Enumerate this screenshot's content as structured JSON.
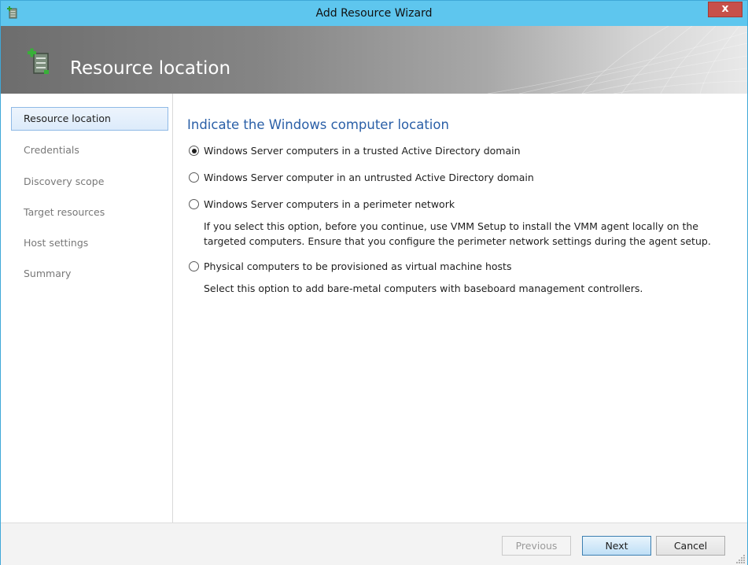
{
  "window": {
    "title": "Add Resource Wizard",
    "close_label": "x",
    "app_icon": "server-add-icon"
  },
  "banner": {
    "title": "Resource location",
    "icon": "server-add-icon"
  },
  "sidebar": {
    "items": [
      {
        "label": "Resource location",
        "active": true
      },
      {
        "label": "Credentials",
        "active": false
      },
      {
        "label": "Discovery scope",
        "active": false
      },
      {
        "label": "Target resources",
        "active": false
      },
      {
        "label": "Host settings",
        "active": false
      },
      {
        "label": "Summary",
        "active": false
      }
    ]
  },
  "main": {
    "heading": "Indicate the Windows computer location",
    "options": [
      {
        "label": "Windows Server computers in a trusted Active Directory domain",
        "checked": true
      },
      {
        "label": "Windows Server computer in an untrusted Active Directory domain",
        "checked": false
      },
      {
        "label": "Windows Server computers in a perimeter network",
        "checked": false,
        "description_line1": "If you select this option, before you continue, use VMM Setup to install the VMM agent locally on the",
        "description_line2": "targeted computers. Ensure that you configure the perimeter network settings during the agent setup."
      },
      {
        "label": "Physical computers to be provisioned as virtual machine hosts",
        "checked": false,
        "description_line1": "Select this option to add bare-metal computers with baseboard management controllers."
      }
    ]
  },
  "footer": {
    "previous_label": "Previous",
    "next_label": "Next",
    "cancel_label": "Cancel"
  },
  "colors": {
    "titlebar": "#5ec6ee",
    "heading": "#2a5fa7",
    "close_button": "#c7504a"
  }
}
